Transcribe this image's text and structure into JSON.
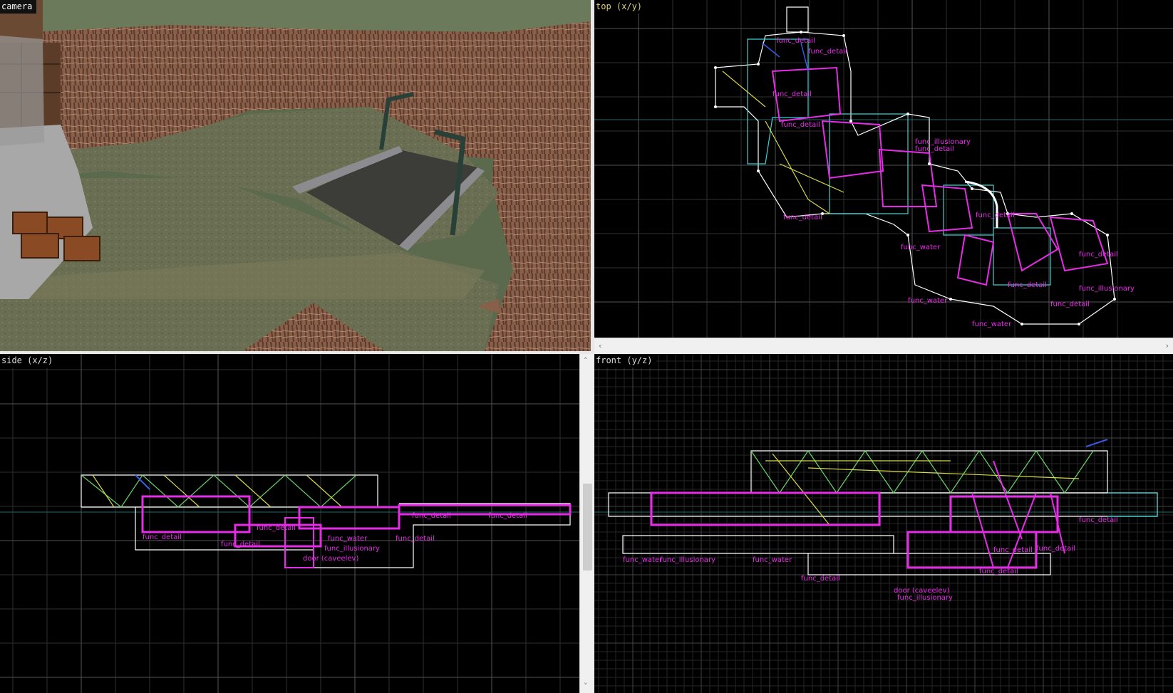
{
  "viewports": {
    "camera": {
      "label": "camera"
    },
    "top": {
      "label": "top (x/y)"
    },
    "side": {
      "label": "side (x/z)"
    },
    "front": {
      "label": "front (y/z)"
    }
  },
  "entity_labels": {
    "top": [
      "func_detail",
      "func_detail",
      "func_detail",
      "func_detail",
      "func_illusionary",
      "func_detail",
      "func_detail",
      "func_water",
      "func_water",
      "func_water",
      "func_detail",
      "func_illusionary",
      "func_detail",
      "func_detail",
      "func_detail"
    ],
    "side": [
      "func_detail",
      "func_detail",
      "func_detail",
      "func_water",
      "func_illusionary",
      "func_detail",
      "door (caveelev)",
      "func_detail",
      "func_detail"
    ],
    "front": [
      "func_water",
      "func_illusionary",
      "func_water",
      "func_detail",
      "func_detail",
      "func_detail",
      "func_detail",
      "door (caveelev)",
      "func_detail",
      "func_illusionary"
    ]
  },
  "colors": {
    "grid_minor": "#2a2a2a",
    "grid_major": "#4a4a4a",
    "grid_axis": "#1e6a6a",
    "brush_white": "#ffffff",
    "brush_cyan": "#3ad3d3",
    "brush_magenta": "#e62ce6",
    "brush_yellow": "#d8d84a",
    "brush_green": "#6ad46a",
    "brush_blue": "#3a5ae6"
  }
}
